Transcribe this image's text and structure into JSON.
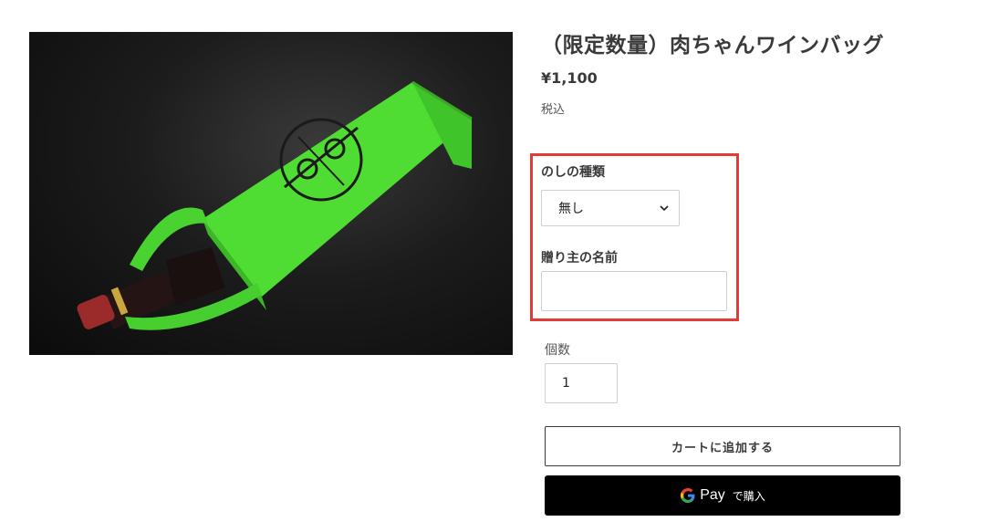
{
  "product": {
    "title": "（限定数量）肉ちゃんワインバッグ",
    "price": "¥1,100",
    "tax_note": "税込",
    "image_alt": "肉ちゃんワインバッグ"
  },
  "options": {
    "noshi_label": "のしの種類",
    "noshi_selected": "無し",
    "sender_label": "贈り主の名前",
    "sender_value": ""
  },
  "quantity": {
    "label": "個数",
    "value": "1"
  },
  "actions": {
    "add_to_cart": "カートに追加する",
    "gpay_brand": "Pay",
    "gpay_buy": "で購入"
  },
  "colors": {
    "bag_green": "#54e23a",
    "highlight": "#e53935",
    "gpay_bg": "#000000"
  },
  "icons": [
    "chevron-down-icon",
    "google-g-icon"
  ]
}
